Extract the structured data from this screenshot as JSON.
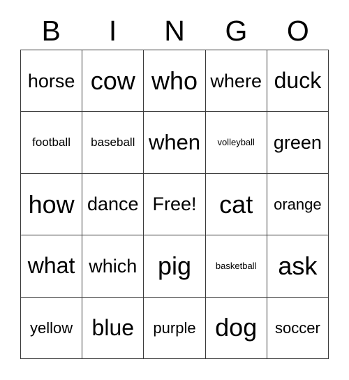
{
  "card": {
    "title": "BINGO",
    "header_letters": [
      "B",
      "I",
      "N",
      "G",
      "O"
    ],
    "grid_size": "5x5",
    "free_space": "Free!",
    "colors": {
      "background": "#ffffff",
      "text": "#000000",
      "border": "#3a3a3a"
    },
    "rows": [
      [
        {
          "text": "horse"
        },
        {
          "text": "cow"
        },
        {
          "text": "who"
        },
        {
          "text": "where"
        },
        {
          "text": "duck"
        }
      ],
      [
        {
          "text": "football"
        },
        {
          "text": "baseball"
        },
        {
          "text": "when"
        },
        {
          "text": "volleyball"
        },
        {
          "text": "green"
        }
      ],
      [
        {
          "text": "how"
        },
        {
          "text": "dance"
        },
        {
          "text": "Free!"
        },
        {
          "text": "cat"
        },
        {
          "text": "orange"
        }
      ],
      [
        {
          "text": "what"
        },
        {
          "text": "which"
        },
        {
          "text": "pig"
        },
        {
          "text": "basketball"
        },
        {
          "text": "ask"
        }
      ],
      [
        {
          "text": "yellow"
        },
        {
          "text": "blue"
        },
        {
          "text": "purple"
        },
        {
          "text": "dog"
        },
        {
          "text": "soccer"
        }
      ]
    ]
  }
}
